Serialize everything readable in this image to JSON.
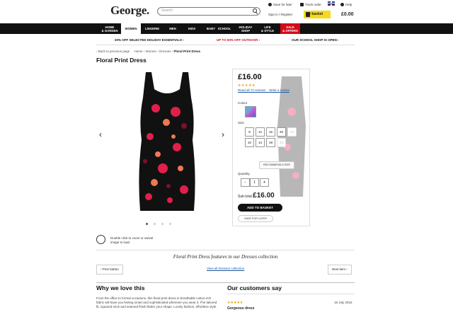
{
  "header": {
    "logo": "George.",
    "search_placeholder": "Search",
    "save_for_later": "Save for later",
    "track_order": "Track order",
    "help": "Help",
    "sign_in": "Sign in / Register",
    "basket_label": "My basket",
    "basket_total": "£0.00"
  },
  "nav": [
    {
      "label": "HOME\n& GARDEN"
    },
    {
      "label": "WOMEN"
    },
    {
      "label": "LINGERIE"
    },
    {
      "label": "MEN"
    },
    {
      "label": "KIDS"
    },
    {
      "label": "BABY"
    },
    {
      "label": "SCHOOL"
    },
    {
      "label": "HOLIDAY\nSHOP"
    },
    {
      "label": "LIFE\n& STYLE"
    },
    {
      "label": "SALE\n& OFFERS"
    }
  ],
  "promos": {
    "left": "20% OFF SELECTED HOLIDAY ESSENTIALS ›",
    "middle": "UP TO 50% OFF OUTDOOR ›",
    "right": "OUR SCHOOL SHOP IS OPEN ›"
  },
  "breadcrumb": {
    "back": "‹ Back to previous page",
    "path": "Home › Women › Dresses ›",
    "current": "Floral Print Dress"
  },
  "product": {
    "title": "Floral Print Dress",
    "price": "£16.00",
    "stars": "★★★★★",
    "read_reviews": "Read all 72 reviews",
    "write_review": "Write a review",
    "colour_label": "Colour",
    "size_label": "Size",
    "sizes": [
      "8",
      "10",
      "12",
      "14",
      "16",
      "18",
      "20",
      "22",
      "24"
    ],
    "recommend_size": "RECOMMEND A SIZE",
    "quantity_label": "Quantity",
    "quantity_minus": "−",
    "quantity_value": "1",
    "quantity_plus": "+",
    "subtotal_label": "Sub total",
    "subtotal_value": "£16.00",
    "add_to_basket": "ADD TO BASKET",
    "save_for_later": "SAVE FOR LATER",
    "zoom_hint": "Double click to zoom or swivel image to load",
    "prev_arrow": "‹",
    "next_arrow": "›"
  },
  "collection": {
    "text": "Floral Print Dress features in our Dresses collection",
    "prev": "‹ Prev button",
    "view_all": "View all Dresses collection",
    "next": "Next item ›"
  },
  "why": {
    "heading": "Why we love this",
    "body": "From the office to formal occasions, this floral print dress in breathable cotton-rich fabric will have you feeling smart and sophisticated wherever you wear it. The tailored fit, squared neck and seamed finish flatter your shape. Lovely fashion, effortless style."
  },
  "customers": {
    "heading": "Our customers say",
    "stars": "★★★★★",
    "date": "18 July 2016",
    "review_title": "Gorgeous dress"
  },
  "colors": {
    "brand_yellow": "#f5d91c",
    "sale_red": "#d40c1a",
    "nav_black": "#111111"
  }
}
